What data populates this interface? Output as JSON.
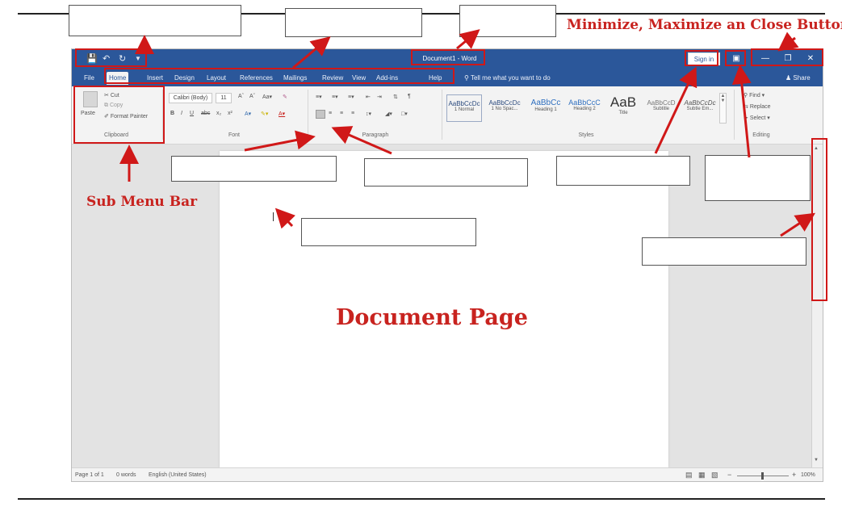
{
  "annotations": {
    "window_buttons_label": "Minimize, Maximize an Close Buttons",
    "sub_menu_bar_label": "Sub Menu Bar",
    "document_page_label": "Document Page"
  },
  "titlebar": {
    "document_title": "Document1 - Word",
    "sign_in": "Sign in",
    "icons": [
      "save-icon",
      "undo-icon",
      "redo-icon",
      "customize-qat-icon",
      "ribbon-display-options-icon",
      "minimize-icon",
      "restore-icon",
      "close-icon"
    ]
  },
  "tabs": [
    "File",
    "Home",
    "Insert",
    "Design",
    "Layout",
    "References",
    "Mailings",
    "Review",
    "View",
    "Add-ins",
    "Help"
  ],
  "active_tab": "Home",
  "tell_me": "Tell me what you want to do",
  "share": "Share",
  "ribbon": {
    "clipboard": {
      "paste": "Paste",
      "cut": "Cut",
      "copy": "Copy",
      "format_painter": "Format Painter",
      "label": "Clipboard"
    },
    "font": {
      "font_name": "Calibri (Body)",
      "font_size": "11",
      "label": "Font"
    },
    "paragraph": {
      "label": "Paragraph"
    },
    "styles": {
      "items": [
        {
          "preview": "AaBbCcDc",
          "name": "1 Normal"
        },
        {
          "preview": "AaBbCcDc",
          "name": "1 No Spac..."
        },
        {
          "preview": "AaBbCc",
          "name": "Heading 1"
        },
        {
          "preview": "AaBbCcC",
          "name": "Heading 2"
        },
        {
          "preview": "AaB",
          "name": "Title"
        },
        {
          "preview": "AaBbCcD",
          "name": "Subtitle"
        },
        {
          "preview": "AaBbCcDc",
          "name": "Subtle Em..."
        }
      ],
      "label": "Styles"
    },
    "editing": {
      "find": "Find",
      "replace": "Replace",
      "select": "Select",
      "label": "Editing"
    }
  },
  "statusbar": {
    "page": "Page 1 of 1",
    "words": "0 words",
    "language": "English (United States)",
    "zoom": "100%"
  },
  "colors": {
    "word_blue": "#2b579a",
    "annotation_red": "#c8231f"
  }
}
